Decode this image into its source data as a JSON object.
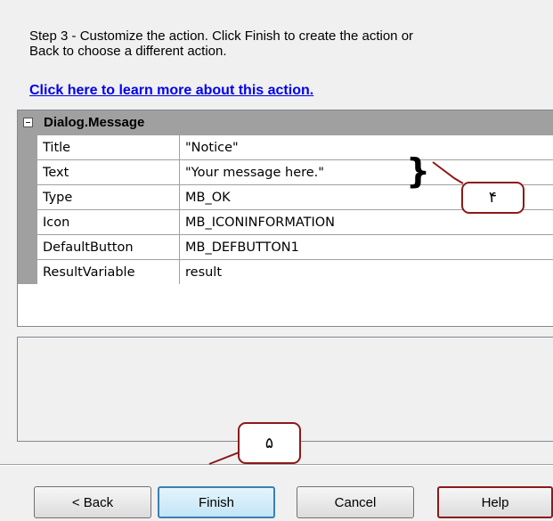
{
  "instructions": "Step 3 - Customize the action.  Click Finish to create the action or\nBack to choose a different action.",
  "learn_more_link": "Click here to learn more about this action.",
  "property_grid": {
    "category": "Dialog.Message",
    "rows": [
      {
        "name": "Title",
        "value": "\"Notice\""
      },
      {
        "name": "Text",
        "value": "\"Your message here.\""
      },
      {
        "name": "Type",
        "value": "MB_OK"
      },
      {
        "name": "Icon",
        "value": "MB_ICONINFORMATION"
      },
      {
        "name": "DefaultButton",
        "value": "MB_DEFBUTTON1"
      },
      {
        "name": "ResultVariable",
        "value": "result"
      }
    ]
  },
  "buttons": {
    "back": "< Back",
    "finish": "Finish",
    "cancel": "Cancel",
    "help": "Help"
  },
  "annotations": {
    "callout_4": "۴",
    "callout_5": "۵",
    "brace": "}"
  },
  "colors": {
    "grid_header": "#a0a0a0",
    "link": "#0000ee",
    "callout_border": "#8b1a1a",
    "finish_border": "#3c7fb1"
  }
}
